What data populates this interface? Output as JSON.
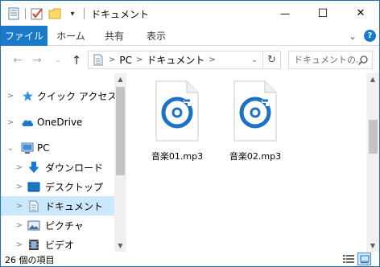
{
  "window": {
    "title": "ドキュメント",
    "minimize_glyph": "—",
    "maximize_glyph": "☐",
    "close_glyph": "✕"
  },
  "qat": {
    "dropdown_glyph": "▾"
  },
  "ribbon": {
    "tabs": [
      {
        "label": "ファイル"
      },
      {
        "label": "ホーム"
      },
      {
        "label": "共有"
      },
      {
        "label": "表示"
      }
    ],
    "expand_glyph": "⌄",
    "help_glyph": "?"
  },
  "address": {
    "back_glyph": "←",
    "forward_glyph": "→",
    "recent_glyph": "⌄",
    "up_glyph": "↑",
    "crumbs": [
      "PC",
      "ドキュメント"
    ],
    "chevron_glyph": ">",
    "dropdown_glyph": "⌄",
    "refresh_glyph": "↻"
  },
  "search": {
    "placeholder": "ドキュメントの..."
  },
  "nav": {
    "items": [
      {
        "label": "クイック アクセス",
        "expander": ">",
        "icon": "star-icon"
      },
      {
        "label": "OneDrive",
        "expander": ">",
        "icon": "cloud-icon"
      },
      {
        "label": "PC",
        "expander": "⌄",
        "icon": "computer-icon"
      },
      {
        "label": "ダウンロード",
        "expander": ">",
        "icon": "download-icon"
      },
      {
        "label": "デスクトップ",
        "expander": ">",
        "icon": "desktop-icon"
      },
      {
        "label": "ドキュメント",
        "expander": ">",
        "icon": "document-icon"
      },
      {
        "label": "ピクチャ",
        "expander": ">",
        "icon": "pictures-icon"
      },
      {
        "label": "ビデオ",
        "expander": ">",
        "icon": "videos-icon"
      }
    ],
    "selected_index": 5
  },
  "scrollbar": {
    "up_glyph": "▲",
    "down_glyph": "▼"
  },
  "files": [
    {
      "name": "音楽01.mp3",
      "icon": "groove-music-file-icon"
    },
    {
      "name": "音楽02.mp3",
      "icon": "groove-music-file-icon"
    }
  ],
  "status": {
    "item_count": "26 個の項目"
  },
  "colors": {
    "accent": "#1979ca",
    "selection": "#cce8ff",
    "music_icon": "#1a73c8"
  }
}
